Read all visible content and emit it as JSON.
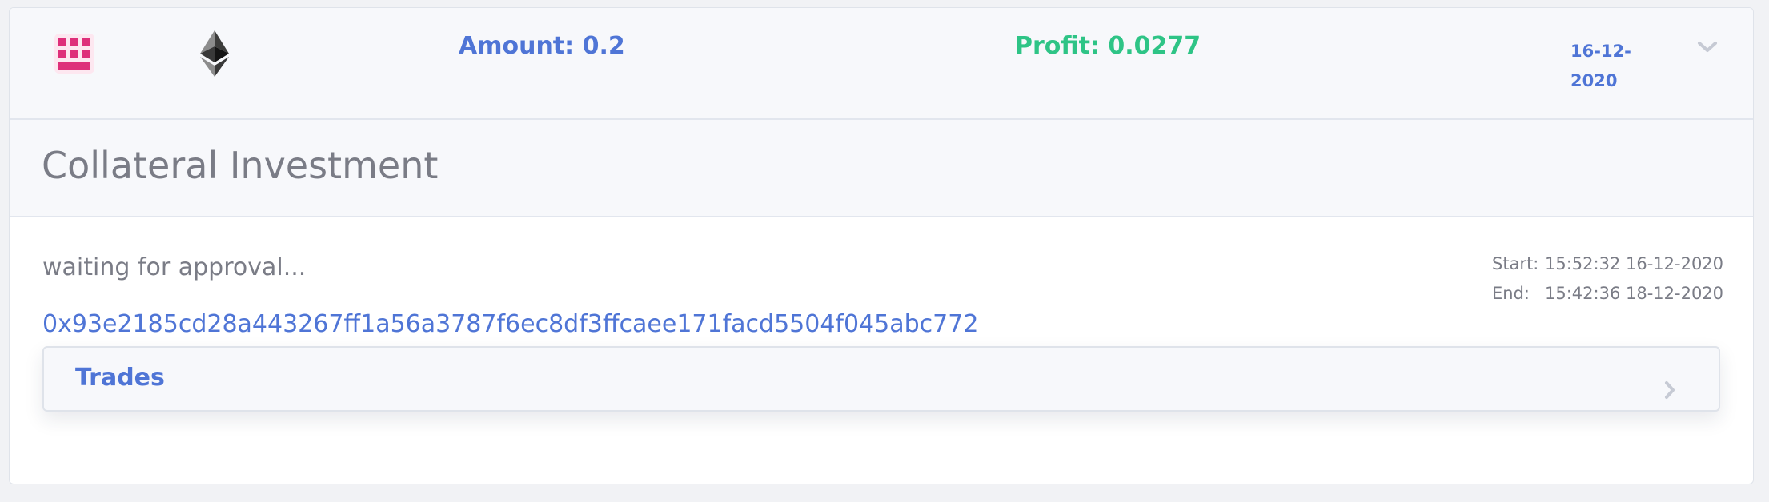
{
  "header": {
    "logo_icon": "pixel-w-logo-icon",
    "coin_icon": "ethereum-icon",
    "amount_text": "Amount: 0.2",
    "profit_text": "Profit: 0.0277",
    "date_line1": "16-12-",
    "date_line2": "2020",
    "expand_icon": "chevron-down-icon"
  },
  "section": {
    "title": "Collateral Investment"
  },
  "body": {
    "status": "waiting for approval...",
    "tx_hash": "0x93e2185cd28a443267ff1a56a3787f6ec8df3ffcaee171facd5504f045abc772",
    "start_label": "Start:",
    "start_value": "15:52:32 16-12-2020",
    "end_label": "End:",
    "end_value": "15:42:36 18-12-2020"
  },
  "trades": {
    "label": "Trades",
    "expand_icon": "chevron-right-icon"
  },
  "colors": {
    "accent": "#4f75d6",
    "profit": "#2ec486",
    "logo": "#de2f7a",
    "muted_text": "#7a7c86"
  }
}
